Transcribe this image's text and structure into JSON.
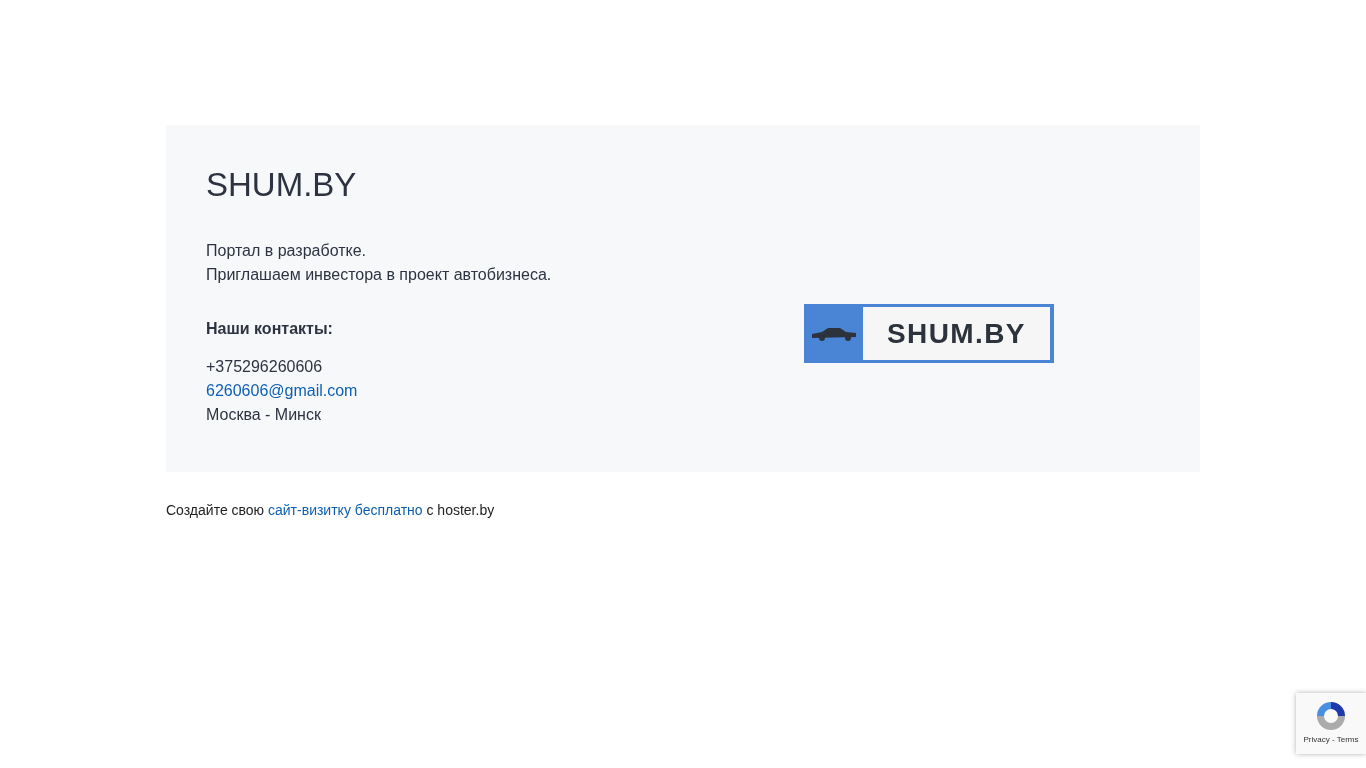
{
  "card": {
    "title": "SHUM.BY",
    "intro": [
      "Портал в разработке.",
      "Приглашаем инвестора в проект автобизнеса."
    ],
    "contacts_heading": "Наши контакты:",
    "phone": "+375296260606",
    "email": "6260606@gmail.com",
    "cities": "Москва - Минск",
    "logo_text": "SHUM.BY"
  },
  "footer": {
    "before": "Создайте свою",
    "link": "сайт-визитку бесплатно",
    "after": "с hoster.by"
  },
  "recaptcha": {
    "links": "Privacy - Terms"
  }
}
